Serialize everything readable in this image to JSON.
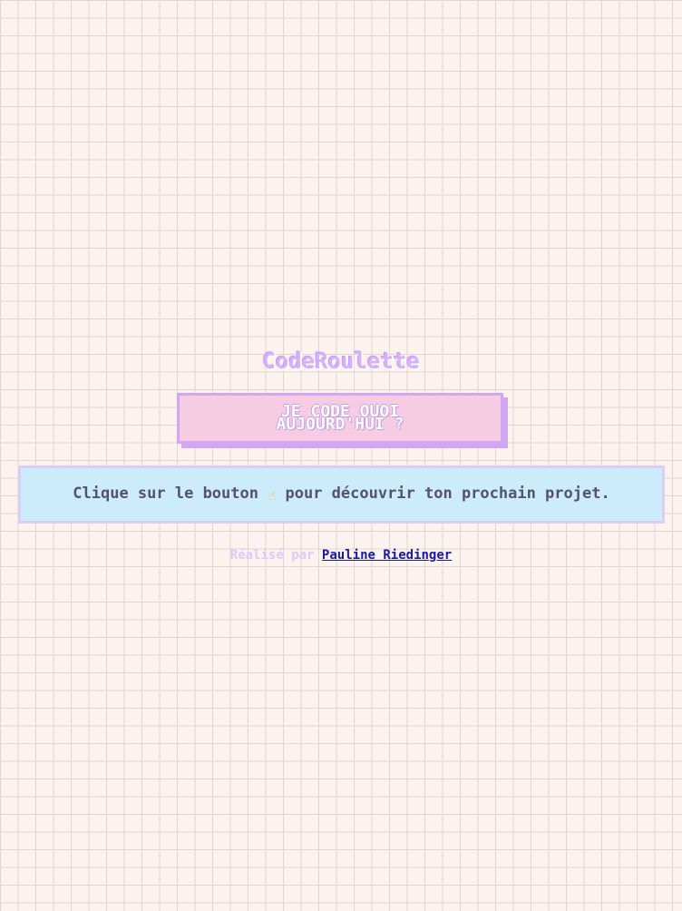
{
  "app": {
    "title": "CodeRoulette"
  },
  "roll_button": {
    "label": "JE CODE QUOI\nAUJOURD'HUI ?"
  },
  "message": {
    "before_icon": "Clique sur le bouton ",
    "icon": "pointing-hand-icon",
    "after_icon": " pour découvrir ton prochain projet."
  },
  "credit": {
    "prefix": "Réalisé par ",
    "author_link": "Pauline Riedinger"
  },
  "colors": {
    "background": "#fcf3ef",
    "grid": "#e2d6d3",
    "title": "#d6b0fa",
    "button_fill": "#f5cce2",
    "button_border": "#d3a6f3",
    "message_fill": "#ccebfb",
    "message_border": "#dccdf7",
    "link": "#1a1aa8"
  }
}
